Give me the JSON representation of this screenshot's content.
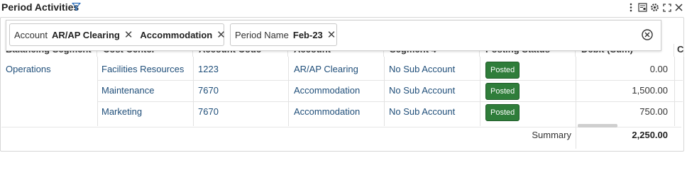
{
  "header": {
    "title": "Period Activities",
    "icons": [
      "filter-icon",
      "more-vertical-icon",
      "report-icon",
      "gear-icon",
      "fullscreen-icon",
      "close-icon"
    ]
  },
  "filters": {
    "chips": [
      {
        "label": "Account",
        "values": [
          "AR/AP Clearing",
          "Accommodation"
        ]
      },
      {
        "label": "Period Name",
        "values": [
          "Feb-23"
        ]
      }
    ]
  },
  "table": {
    "columns": [
      "Balancing Segment",
      "Cost Center",
      "Account Code",
      "Account",
      "Segment 4",
      "Posting Status",
      "Debit (Sum)",
      "Cr"
    ],
    "rows": [
      {
        "balancing_segment": "Operations",
        "cost_center": "Facilities Resources",
        "account_code": "1223",
        "account": "AR/AP Clearing",
        "segment4": "No Sub Account",
        "status": "Posted",
        "debit": "0.00"
      },
      {
        "balancing_segment": "",
        "cost_center": "Maintenance",
        "account_code": "7670",
        "account": "Accommodation",
        "segment4": "No Sub Account",
        "status": "Posted",
        "debit": "1,500.00"
      },
      {
        "balancing_segment": "",
        "cost_center": "Marketing",
        "account_code": "7670",
        "account": "Accommodation",
        "segment4": "No Sub Account",
        "status": "Posted",
        "debit": "750.00"
      }
    ],
    "summary_label": "Summary",
    "summary_debit": "2,250.00"
  },
  "colors": {
    "link": "#1f4e79",
    "posted_badge": "#2f7d3a"
  }
}
